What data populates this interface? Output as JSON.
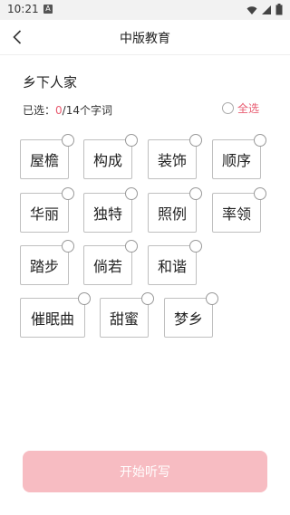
{
  "status_bar": {
    "time": "10:21",
    "notification_letter": "A"
  },
  "nav": {
    "title": "中版教育"
  },
  "unit": {
    "title": "乡下人家"
  },
  "selection": {
    "prefix": "已选：",
    "count": "0",
    "total": "/14个字词",
    "select_all_label": "全选"
  },
  "words": [
    "屋檐",
    "构成",
    "装饰",
    "顺序",
    "华丽",
    "独特",
    "照例",
    "率领",
    "踏步",
    "倘若",
    "和谐",
    "催眠曲",
    "甜蜜",
    "梦乡"
  ],
  "start_button": {
    "label": "开始听写"
  },
  "colors": {
    "accent": "#e85a6f",
    "button_bg": "#f7bcc2"
  }
}
